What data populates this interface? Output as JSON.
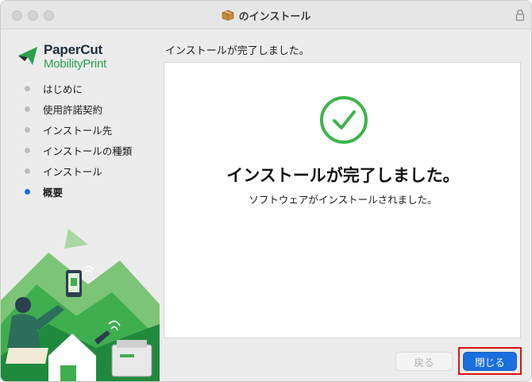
{
  "window": {
    "title": "のインストール"
  },
  "logo": {
    "line1": "PaperCut",
    "line2": "MobilityPrint",
    "mark": "papercut-arrow-logo"
  },
  "sidebar": {
    "steps": [
      {
        "label": "はじめに",
        "active": false
      },
      {
        "label": "使用許諾契約",
        "active": false
      },
      {
        "label": "インストール先",
        "active": false
      },
      {
        "label": "インストールの種類",
        "active": false
      },
      {
        "label": "インストール",
        "active": false
      },
      {
        "label": "概要",
        "active": true
      }
    ]
  },
  "main": {
    "heading": "インストールが完了しました。",
    "done_title": "インストールが完了しました。",
    "done_subtitle": "ソフトウェアがインストールされました。"
  },
  "buttons": {
    "back_label": "戻る",
    "close_label": "閉じる"
  },
  "colors": {
    "accent": "#1a6fe0",
    "success": "#3cb54a",
    "highlight": "#e01010"
  }
}
